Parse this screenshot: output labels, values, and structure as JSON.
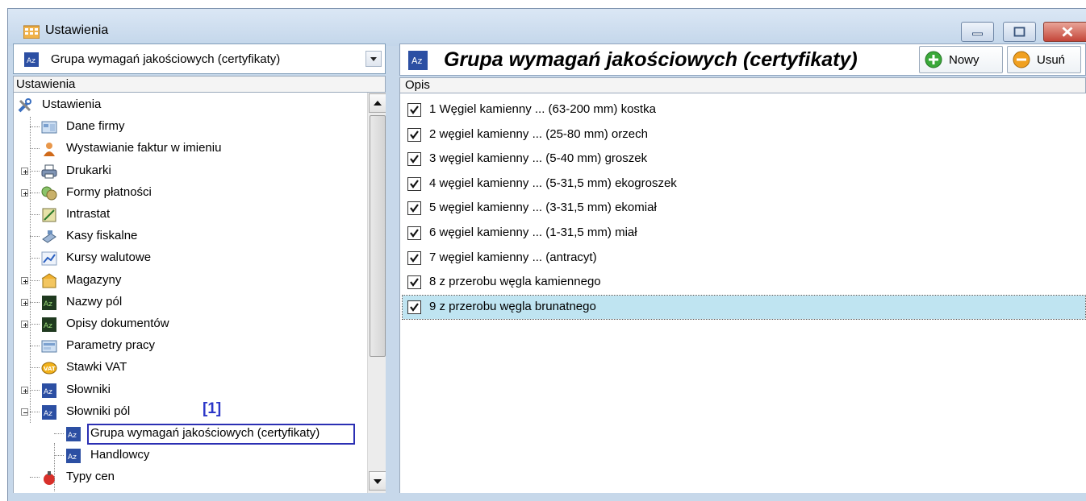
{
  "window": {
    "title": "Ustawienia",
    "icon": "settings-app-icon",
    "buttons": [
      "minimize",
      "maximize",
      "close"
    ]
  },
  "left_panel": {
    "combo_value": "Grupa wymagań jakościowych (certyfikaty)",
    "tree_header": "Ustawienia",
    "tree": [
      {
        "label": "Ustawienia",
        "icon": "tools-icon",
        "level": 0
      },
      {
        "label": "Dane firmy",
        "icon": "company-data-icon",
        "level": 1
      },
      {
        "label": "Wystawianie faktur w imieniu",
        "icon": "person-icon",
        "level": 1
      },
      {
        "label": "Drukarki",
        "icon": "printer-icon",
        "level": 1,
        "expander": "plus"
      },
      {
        "label": "Formy płatności",
        "icon": "payment-icon",
        "level": 1,
        "expander": "plus"
      },
      {
        "label": "Intrastat",
        "icon": "intrastat-icon",
        "level": 1
      },
      {
        "label": "Kasy fiskalne",
        "icon": "cash-register-icon",
        "level": 1
      },
      {
        "label": "Kursy walutowe",
        "icon": "exchange-rate-icon",
        "level": 1
      },
      {
        "label": "Magazyny",
        "icon": "warehouse-icon",
        "level": 1,
        "expander": "plus"
      },
      {
        "label": "Nazwy pól",
        "icon": "az-green-icon",
        "level": 1,
        "expander": "plus"
      },
      {
        "label": "Opisy dokumentów",
        "icon": "az-green-icon",
        "level": 1,
        "expander": "plus"
      },
      {
        "label": "Parametry pracy",
        "icon": "work-params-icon",
        "level": 1
      },
      {
        "label": "Stawki VAT",
        "icon": "vat-icon",
        "level": 1
      },
      {
        "label": "Słowniki",
        "icon": "az-blue-icon",
        "level": 1,
        "expander": "plus"
      },
      {
        "label": "Słowniki pól",
        "icon": "az-blue-icon",
        "level": 1,
        "expander": "minus"
      },
      {
        "label": "Grupa wymagań jakościowych (certyfikaty)",
        "icon": "az-blue-icon",
        "level": 2,
        "selected": true
      },
      {
        "label": "Handlowcy",
        "icon": "az-blue-icon",
        "level": 2
      },
      {
        "label": "Typy cen",
        "icon": "price-types-icon",
        "level": 1
      }
    ],
    "annotation": "[1]"
  },
  "right_panel": {
    "title": "Grupa wymagań jakościowych (certyfikaty)",
    "new_label": "Nowy",
    "delete_label": "Usuń",
    "column_header": "Opis",
    "items": [
      {
        "text": "1 Węgiel kamienny ... (63-200 mm) kostka",
        "checked": true
      },
      {
        "text": "2 węgiel kamienny ... (25-80 mm) orzech",
        "checked": true
      },
      {
        "text": "3 węgiel kamienny ... (5-40 mm) groszek",
        "checked": true
      },
      {
        "text": "4 węgiel kamienny ... (5-31,5 mm) ekogroszek",
        "checked": true
      },
      {
        "text": "5 węgiel kamienny ... (3-31,5 mm) ekomiał",
        "checked": true
      },
      {
        "text": "6 węgiel kamienny ... (1-31,5 mm) miał",
        "checked": true
      },
      {
        "text": "7 węgiel kamienny ... (antracyt)",
        "checked": true
      },
      {
        "text": "8 z przerobu węgla kamiennego",
        "checked": true
      },
      {
        "text": "9 z przerobu węgla brunatnego",
        "checked": true,
        "selected": true
      }
    ]
  }
}
